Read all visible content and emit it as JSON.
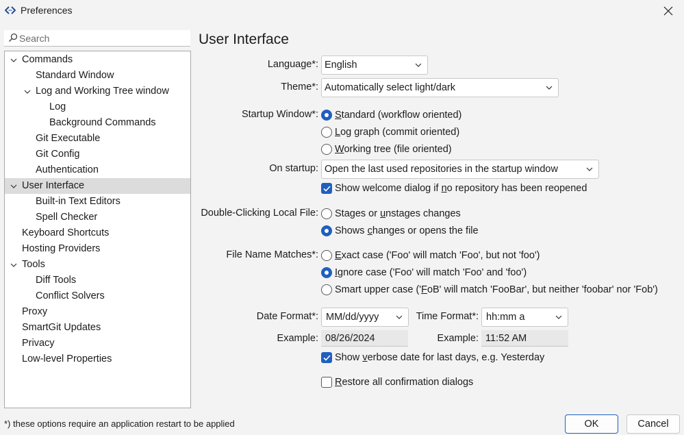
{
  "window": {
    "title": "Preferences"
  },
  "search": {
    "placeholder": "Search",
    "value": ""
  },
  "tree": [
    {
      "label": "Commands",
      "expanded": true
    },
    {
      "label": "Standard Window"
    },
    {
      "label": "Log and Working Tree window",
      "expanded": true
    },
    {
      "label": "Log"
    },
    {
      "label": "Background Commands"
    },
    {
      "label": "Git Executable"
    },
    {
      "label": "Git Config"
    },
    {
      "label": "Authentication"
    },
    {
      "label": "User Interface",
      "expanded": true,
      "selected": true
    },
    {
      "label": "Built-in Text Editors"
    },
    {
      "label": "Spell Checker"
    },
    {
      "label": "Keyboard Shortcuts"
    },
    {
      "label": "Hosting Providers"
    },
    {
      "label": "Tools",
      "expanded": true
    },
    {
      "label": "Diff Tools"
    },
    {
      "label": "Conflict Solvers"
    },
    {
      "label": "Proxy"
    },
    {
      "label": "SmartGit Updates"
    },
    {
      "label": "Privacy"
    },
    {
      "label": "Low-level Properties"
    }
  ],
  "page": {
    "title": "User Interface",
    "language_label": "Language*:",
    "language_value": "English",
    "theme_label": "Theme*:",
    "theme_value": "Automatically select light/dark",
    "startup_window_label": "Startup Window*:",
    "startup_options": [
      {
        "pre": "",
        "u": "S",
        "post": "tandard (workflow oriented)",
        "selected": true
      },
      {
        "pre": "",
        "u": "L",
        "post": "og graph (commit oriented)",
        "selected": false
      },
      {
        "pre": "",
        "u": "W",
        "post": "orking tree (file oriented)",
        "selected": false
      }
    ],
    "on_startup_label": "On startup:",
    "on_startup_value": "Open the last used repositories in the startup window",
    "welcome_check": {
      "pre": "Show welcome dialog if ",
      "u": "n",
      "post": "o repository has been reopened",
      "checked": true
    },
    "double_click_label": "Double-Clicking Local File:",
    "double_click_options": [
      {
        "pre": "Stages or ",
        "u": "u",
        "post": "nstages changes",
        "selected": false
      },
      {
        "pre": "Shows ",
        "u": "c",
        "post": "hanges or opens the file",
        "selected": true
      }
    ],
    "file_name_label": "File Name Matches*:",
    "file_name_options": [
      {
        "pre": "",
        "u": "E",
        "post": "xact case ('Foo' will match 'Foo', but not 'foo')",
        "selected": false
      },
      {
        "pre": "",
        "u": "I",
        "post": "gnore case ('Foo' will match 'Foo' and 'foo')",
        "selected": true
      },
      {
        "pre": "Smart upper case ('",
        "u": "F",
        "post": "oB' will match 'FooBar', but neither 'foobar' nor 'Fob')",
        "selected": false
      }
    ],
    "date_format_label": "Date Format*:",
    "date_format_value": "MM/dd/yyyy",
    "time_format_label": "Time Format*:",
    "time_format_value": "hh:mm a",
    "example_label": "Example:",
    "date_example": "08/26/2024",
    "time_example_label": "Example:",
    "time_example": "11:52 AM",
    "verbose_check": {
      "pre": "Show ",
      "u": "v",
      "post": "erbose date for last days, e.g. Yesterday",
      "checked": true
    },
    "restore_check": {
      "pre": "",
      "u": "R",
      "post": "estore all confirmation dialogs",
      "checked": false
    }
  },
  "footer": {
    "note": "*) these options require an application restart to be applied",
    "ok_label": "OK",
    "cancel_label": "Cancel"
  },
  "colors": {
    "accent": "#1f5fbf",
    "selection": "#dcdcdc",
    "background": "#f3f3f3"
  }
}
